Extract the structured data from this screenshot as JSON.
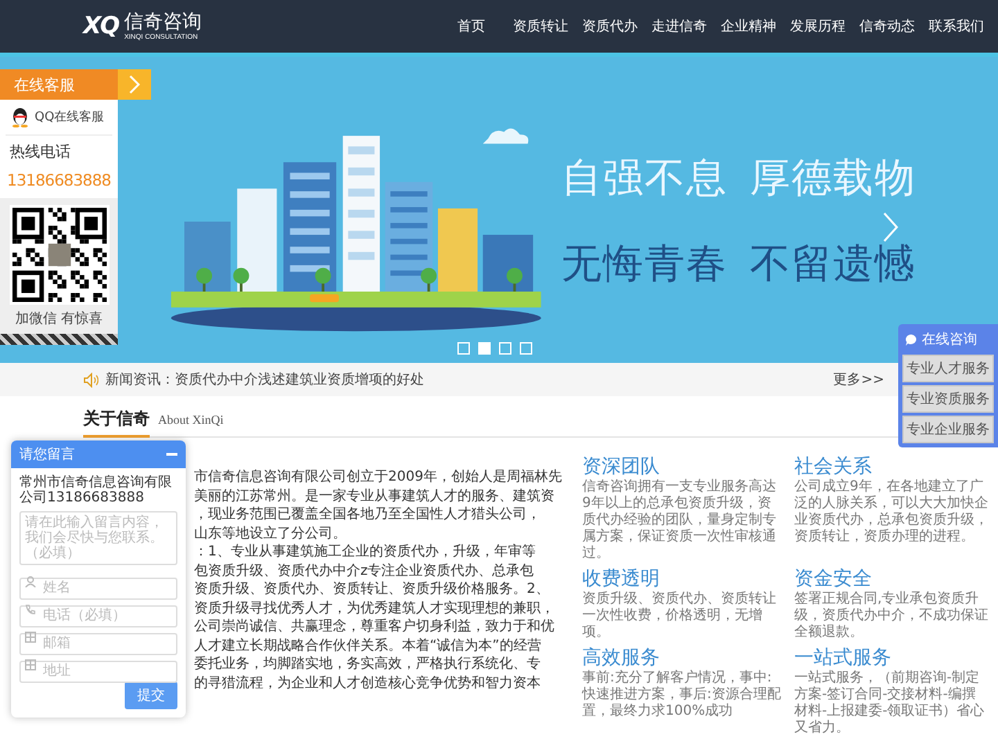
{
  "header": {
    "logo": {
      "mark": "XQ",
      "name": "信奇咨询",
      "subtitle": "XINQI CONSULTATION"
    },
    "nav": [
      {
        "label": "首页"
      },
      {
        "label": "资质转让"
      },
      {
        "label": "资质代办"
      },
      {
        "label": "走进信奇"
      },
      {
        "label": "企业精神"
      },
      {
        "label": "发展历程"
      },
      {
        "label": "信奇动态"
      },
      {
        "label": "联系我们"
      }
    ]
  },
  "banner": {
    "lines": [
      {
        "words": [
          "自强不息",
          "厚德载物"
        ]
      },
      {
        "words": [
          "无悔青春",
          "不留遗憾"
        ]
      }
    ],
    "dots": [
      {
        "selected": false
      },
      {
        "selected": true
      },
      {
        "selected": false
      },
      {
        "selected": false
      }
    ]
  },
  "service_panel": {
    "title": "在线客服",
    "qq_label": "QQ在线客服",
    "hotline_label": "热线电话",
    "phone": "13186683888",
    "qr_caption": "加微信 有惊喜"
  },
  "consult_panel": {
    "title": "在线咨询",
    "buttons": [
      "专业人才服务",
      "专业资质服务",
      "专业企业服务"
    ]
  },
  "news": {
    "text": "新闻资讯：资质代办中介浅述建筑业资质增项的好处",
    "more": "更多>>"
  },
  "about": {
    "title": "关于信奇",
    "subtitle": "About XinQi",
    "lines": [
      "市信奇信息咨询有限公司创立于2009年，创始人是周福林先",
      "美丽的江苏常州。是一家专业从事建筑人才的服务、建筑资",
      "，现业务范围已覆盖全国各地乃至全国性人才猎头公司，",
      "山东等地设立了分公司。",
      "：1、专业从事建筑施工企业的资质代办，升级，年审等",
      "包资质升级、资质代办中介z专注企业资质代办、总承包",
      "资质升级、资质代办、资质转让、资质升级价格服务。2、",
      "资质升级寻找优秀人才，为优秀建筑人才实现理想的兼职，",
      "公司崇尚诚信、共赢理念，尊重客户切身利益，致力于和优",
      "人才建立长期战略合作伙伴关系。本着“诚信为本”的经营",
      "委托业务，均脚踏实地，务实高效，严格执行系统化、专",
      "的寻猎流程，为企业和人才创造核心竞争优势和智力资本"
    ]
  },
  "features": [
    {
      "title": "资深团队",
      "text": "信奇咨询拥有一支专业服务高达9年以上的总承包资质升级，资质代办经验的团队，量身定制专属方案，保证资质一次性审核通过。"
    },
    {
      "title": "社会关系",
      "text": "公司成立9年，在各地建立了广泛的人脉关系，可以大大加快企业资质代办，总承包资质升级，资质转让，资质办理的进程。"
    },
    {
      "title": "收费透明",
      "text": "资质升级、资质代办、资质转让一次性收费，价格透明，无增项。"
    },
    {
      "title": "资金安全",
      "text": "签署正规合同,专业承包资质升级，资质代办中介，不成功保证全额退款。"
    },
    {
      "title": "高效服务",
      "text": "事前:充分了解客户情况，事中:快速推进方案，事后:资源合理配置，最终力求100%成功"
    },
    {
      "title": "一站式服务",
      "text": "一站式服务，（前期咨询-制定方案-签订合同-交接材料-编撰材料-上报建委-领取证书）省心又省力。"
    }
  ],
  "message_form": {
    "title": "请您留言",
    "company": "常州市信奇信息咨询有限公司13186683888",
    "message_placeholder": "请在此输入留言内容，我们会尽快与您联系。（必填）",
    "fields": [
      {
        "kind": "name",
        "placeholder": "姓名"
      },
      {
        "kind": "phone",
        "placeholder": "电话（必填）"
      },
      {
        "kind": "email",
        "placeholder": "邮箱"
      },
      {
        "kind": "address",
        "placeholder": "地址"
      }
    ],
    "submit": "提交"
  }
}
